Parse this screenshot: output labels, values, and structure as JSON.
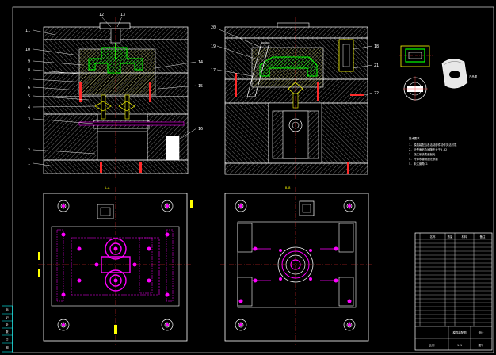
{
  "colors": {
    "background": "#000000",
    "outline": "#ffffff",
    "hatch": "#9a9a9a",
    "cavity_green": "#00ff00",
    "insert_yellow": "#ffff66",
    "leader": "#ffffff",
    "label": "#ffffff",
    "magenta": "#ff00ff",
    "red": "#ff3333",
    "cyan": "#00ffff",
    "yellow": "#ffff00",
    "frame": "#ffffff"
  },
  "views": {
    "front_section": {
      "left_callouts": [
        "11",
        "10",
        "9",
        "8",
        "7",
        "6",
        "5",
        "4",
        "3",
        "2",
        "1"
      ],
      "top_callouts": [
        "12",
        "13"
      ],
      "right_callouts": [
        "14",
        "15",
        "16"
      ]
    },
    "side_section": {
      "left_callouts": [
        "20",
        "19",
        "17"
      ],
      "right_callouts": [
        "18",
        "21",
        "22"
      ]
    },
    "plan_view_left": {
      "section_label": "A—A"
    },
    "plan_view_right": {
      "section_label": "B—B"
    },
    "product": {
      "caption": "产品图"
    },
    "notes": {
      "heading": "技术要求",
      "lines": [
        "1. 模具装配后各活动部件动作灵活可靠",
        "2. 分型面贴合间隙不大于0.02",
        "3. 浇注系统表面抛光",
        "4. 冷却水道畅通无渗漏",
        "5. 未注倒角C1"
      ]
    }
  },
  "title_block": {
    "title": "模具装配图",
    "institution": "设计",
    "row_labels": [
      "名称",
      "数量",
      "材料",
      "备注"
    ],
    "bottom_cells": [
      "比例",
      "1:1",
      "图号"
    ]
  },
  "revision_strip": {
    "cells": [
      "标",
      "记",
      "处",
      "数",
      "日",
      "期"
    ]
  }
}
